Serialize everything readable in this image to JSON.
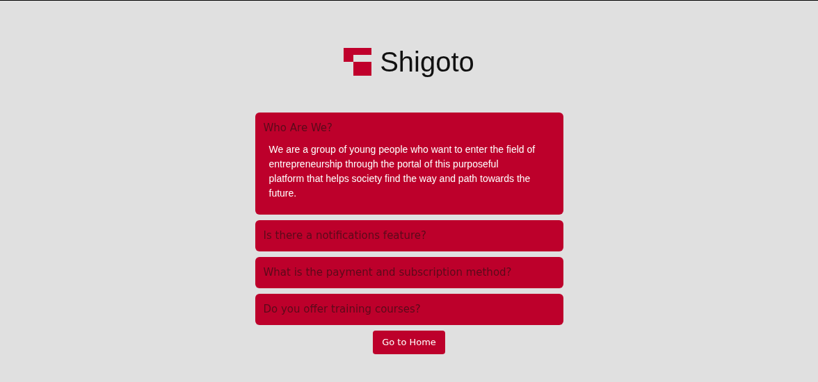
{
  "logo": {
    "text": "Shigoto"
  },
  "faqs": [
    {
      "question": "Who Are We?",
      "expanded": true,
      "answer": "We are a group of young people who want to enter the field of entrepreneurship through the portal of this purposeful platform that helps society find the way and path towards the future."
    },
    {
      "question": "Is there a notifications feature?",
      "expanded": false
    },
    {
      "question": "What is the payment and subscription method?",
      "expanded": false
    },
    {
      "question": "Do you offer training courses?",
      "expanded": false
    }
  ],
  "button": "Go to Home"
}
